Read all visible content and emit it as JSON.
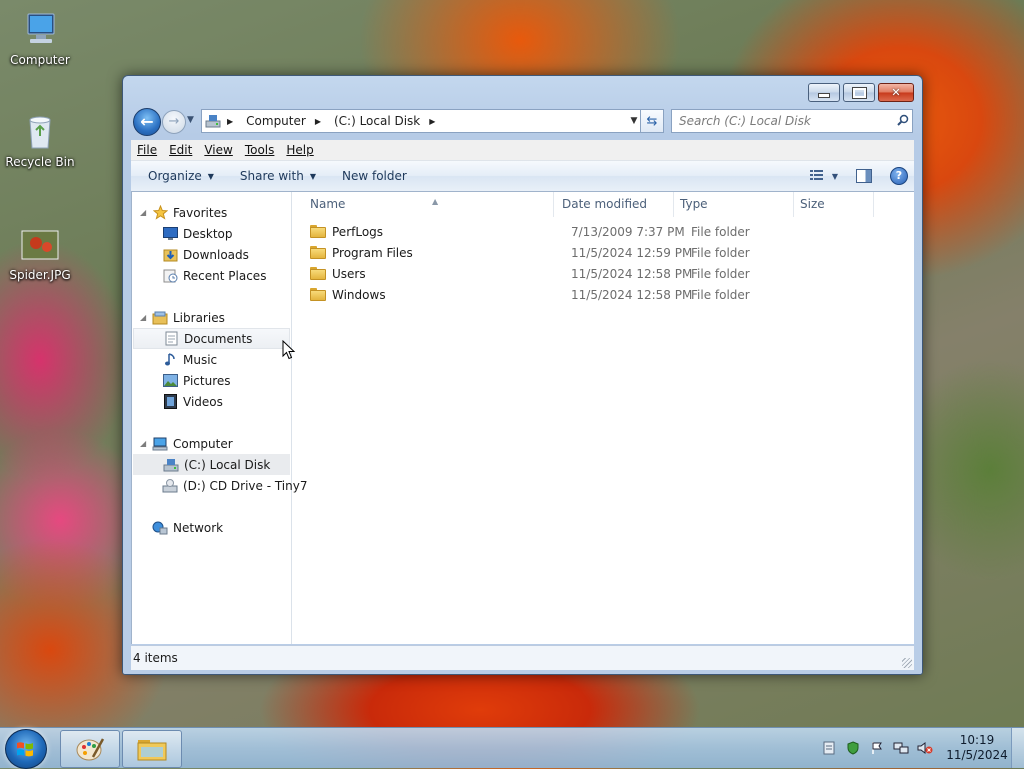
{
  "desktop": {
    "icons": [
      {
        "label": "Computer"
      },
      {
        "label": "Recycle Bin"
      },
      {
        "label": "Spider.JPG"
      }
    ]
  },
  "window": {
    "address": {
      "crumbs": [
        "Computer",
        "(C:) Local Disk"
      ]
    },
    "search": {
      "placeholder": "Search (C:) Local Disk"
    },
    "menu": [
      "File",
      "Edit",
      "View",
      "Tools",
      "Help"
    ],
    "toolbar": {
      "organize": "Organize",
      "share_with": "Share with",
      "new_folder": "New folder"
    },
    "nav": {
      "favorites": {
        "label": "Favorites",
        "items": [
          "Desktop",
          "Downloads",
          "Recent Places"
        ]
      },
      "libraries": {
        "label": "Libraries",
        "items": [
          "Documents",
          "Music",
          "Pictures",
          "Videos"
        ]
      },
      "computer": {
        "label": "Computer",
        "items": [
          "(C:) Local Disk",
          "(D:) CD Drive - Tiny7"
        ]
      },
      "network": {
        "label": "Network"
      }
    },
    "columns": [
      "Name",
      "Date modified",
      "Type",
      "Size"
    ],
    "files": [
      {
        "name": "PerfLogs",
        "date": "7/13/2009 7:37 PM",
        "type": "File folder"
      },
      {
        "name": "Program Files",
        "date": "11/5/2024 12:59 PM",
        "type": "File folder"
      },
      {
        "name": "Users",
        "date": "11/5/2024 12:58 PM",
        "type": "File folder"
      },
      {
        "name": "Windows",
        "date": "11/5/2024 12:58 PM",
        "type": "File folder"
      }
    ],
    "status": "4 items"
  },
  "taskbar": {
    "time": "10:19",
    "date": "11/5/2024"
  },
  "icons": {
    "address": "drive-icon",
    "search": "search-icon",
    "refresh": "refresh-icon",
    "help": "help-icon"
  },
  "colors": {
    "window_frame": "#b9cde7",
    "command_bar": "#e4edf7",
    "taskbar": "#a4c4e0",
    "start_orb": "#1e68b8",
    "folder": "#e4b53e"
  }
}
